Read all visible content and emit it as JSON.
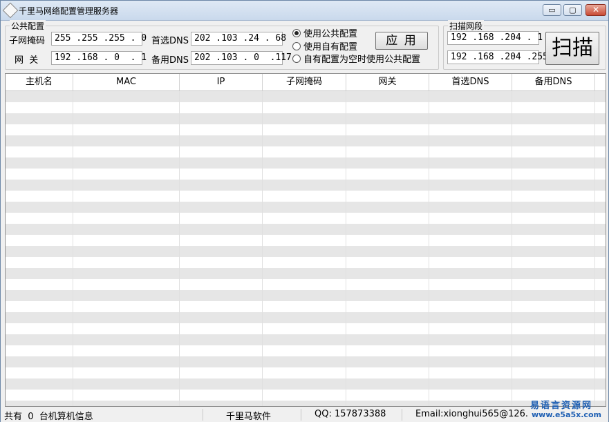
{
  "window": {
    "title": "千里马网络配置管理服务器",
    "minimize": "▭",
    "maximize": "▢",
    "close": "✕"
  },
  "public_config": {
    "legend": "公共配置",
    "subnet_label": "子网掩码",
    "subnet_value": "255 .255 .255 . 0",
    "gateway_label": "网  关",
    "gateway_value": "192 .168 . 0  . 1",
    "dns1_label": "首选DNS",
    "dns1_value": "202 .103 .24 . 68",
    "dns2_label": "备用DNS",
    "dns2_value": "202 .103 . 0  .117",
    "radio_public": "使用公共配置",
    "radio_own": "使用自有配置",
    "radio_fallback": "自有配置为空时使用公共配置",
    "selected_option": "使用公共配置",
    "apply_label": "应 用"
  },
  "scan": {
    "legend": "扫描网段",
    "start_ip": "192 .168 .204 . 1",
    "end_ip": "192 .168 .204 .255",
    "scan_label": "扫描"
  },
  "table": {
    "columns": [
      "主机名",
      "MAC",
      "IP",
      "子网掩码",
      "网关",
      "首选DNS",
      "备用DNS"
    ]
  },
  "status": {
    "count_text": "共有  0  台机算机信息",
    "company": "千里马软件",
    "qq": "QQ: 157873388",
    "email": "Email:xionghui565@126."
  },
  "watermark": {
    "line1": "易语言资源网",
    "line2": "www.e5a5x.com"
  },
  "colors": {
    "accent_close": "#c94b35",
    "watermark": "#1e5fb3"
  }
}
